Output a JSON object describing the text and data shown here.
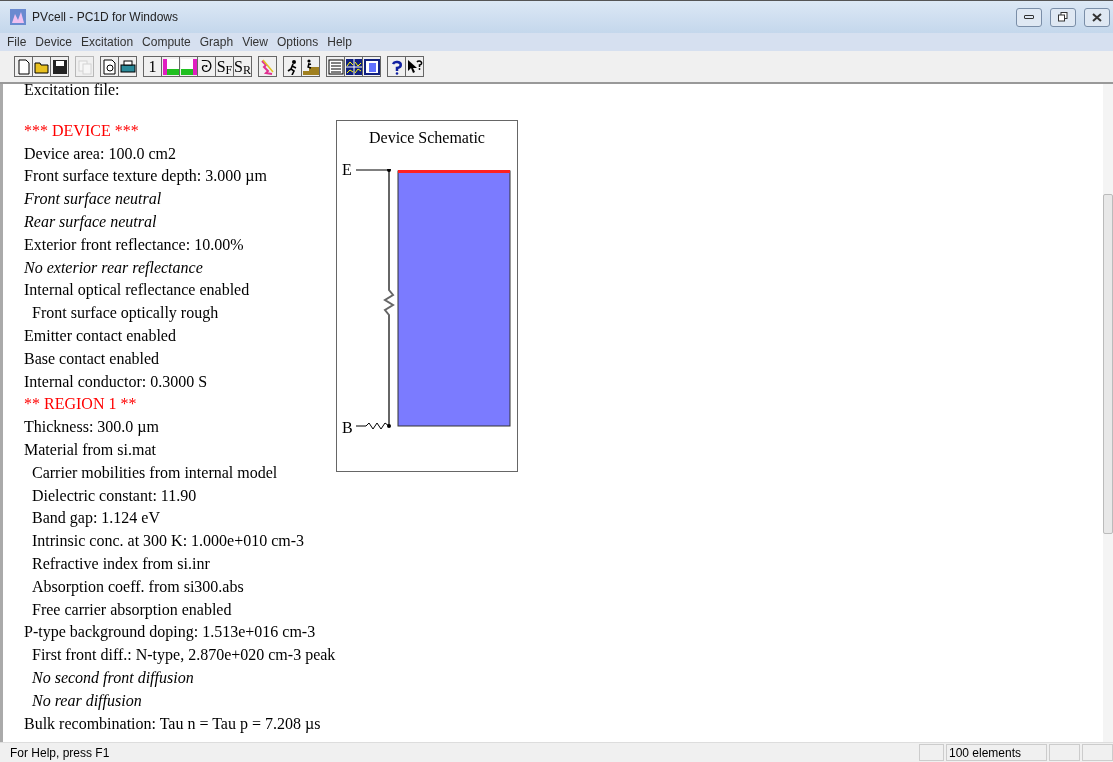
{
  "window": {
    "title": "PVcell - PC1D for Windows"
  },
  "menu": [
    "File",
    "Device",
    "Excitation",
    "Compute",
    "Graph",
    "View",
    "Options",
    "Help"
  ],
  "toolbar": [
    {
      "kind": "new"
    },
    {
      "kind": "open"
    },
    {
      "kind": "save"
    },
    {
      "kind": "sep"
    },
    {
      "kind": "copy",
      "disabled": true
    },
    {
      "kind": "sep"
    },
    {
      "kind": "preview"
    },
    {
      "kind": "print"
    },
    {
      "kind": "sep"
    },
    {
      "kind": "text",
      "label": "1"
    },
    {
      "kind": "front"
    },
    {
      "kind": "rear"
    },
    {
      "kind": "text",
      "label": "ᘒ"
    },
    {
      "kind": "text",
      "label": "S$_{F}$"
    },
    {
      "kind": "text",
      "label": "S$_{R}$"
    },
    {
      "kind": "sep"
    },
    {
      "kind": "light"
    },
    {
      "kind": "sep"
    },
    {
      "kind": "run"
    },
    {
      "kind": "step"
    },
    {
      "kind": "sep"
    },
    {
      "kind": "parameters"
    },
    {
      "kind": "graphs"
    },
    {
      "kind": "schematic"
    },
    {
      "kind": "sep"
    },
    {
      "kind": "help"
    },
    {
      "kind": "whatsthis"
    }
  ],
  "lines": [
    {
      "text": "Excitation file:",
      "kind": "plain",
      "indent": false
    },
    {
      "text": "*** DEVICE ***",
      "kind": "heading",
      "indent": false
    },
    {
      "text": "Device area: 100.0 cm2",
      "kind": "plain",
      "indent": false
    },
    {
      "text": "Front surface texture depth: 3.000 µm",
      "kind": "plain",
      "indent": false
    },
    {
      "text": "Front surface neutral",
      "kind": "italic",
      "indent": false
    },
    {
      "text": "Rear surface neutral",
      "kind": "italic",
      "indent": false
    },
    {
      "text": "Exterior front reflectance: 10.00%",
      "kind": "plain",
      "indent": false
    },
    {
      "text": "No exterior rear reflectance",
      "kind": "italic",
      "indent": false
    },
    {
      "text": "Internal optical reflectance enabled",
      "kind": "plain",
      "indent": false
    },
    {
      "text": "Front surface optically rough",
      "kind": "plain",
      "indent": true
    },
    {
      "text": "Emitter contact enabled",
      "kind": "plain",
      "indent": false
    },
    {
      "text": "Base contact enabled",
      "kind": "plain",
      "indent": false
    },
    {
      "text": "Internal conductor: 0.3000 S",
      "kind": "plain",
      "indent": false
    },
    {
      "text": "** REGION 1 **",
      "kind": "heading",
      "indent": false
    },
    {
      "text": "Thickness: 300.0 µm",
      "kind": "plain",
      "indent": false
    },
    {
      "text": "Material from si.mat",
      "kind": "plain",
      "indent": false
    },
    {
      "text": "Carrier mobilities from internal model",
      "kind": "plain",
      "indent": true
    },
    {
      "text": "Dielectric constant: 11.90",
      "kind": "plain",
      "indent": true
    },
    {
      "text": "Band gap: 1.124 eV",
      "kind": "plain",
      "indent": true
    },
    {
      "text": "Intrinsic conc. at 300 K: 1.000e+010 cm-3",
      "kind": "plain",
      "indent": true
    },
    {
      "text": "Refractive index from si.inr",
      "kind": "plain",
      "indent": true
    },
    {
      "text": "Absorption coeff. from si300.abs",
      "kind": "plain",
      "indent": true
    },
    {
      "text": "Free carrier absorption enabled",
      "kind": "plain",
      "indent": true
    },
    {
      "text": "P-type background doping: 1.513e+016 cm-3",
      "kind": "plain",
      "indent": false
    },
    {
      "text": "First front diff.: N-type, 2.870e+020 cm-3 peak",
      "kind": "plain",
      "indent": true
    },
    {
      "text": "No second front diffusion",
      "kind": "italic",
      "indent": true
    },
    {
      "text": "No rear diffusion",
      "kind": "italic",
      "indent": true
    },
    {
      "text": "Bulk recombination: Tau n = Tau p = 7.208 µs",
      "kind": "plain",
      "indent": false
    }
  ],
  "schematic": {
    "title": "Device Schematic",
    "emitter_label": "E",
    "base_label": "B"
  },
  "status_bar": {
    "message": "For Help, press F1",
    "element_count": "100 elements"
  }
}
